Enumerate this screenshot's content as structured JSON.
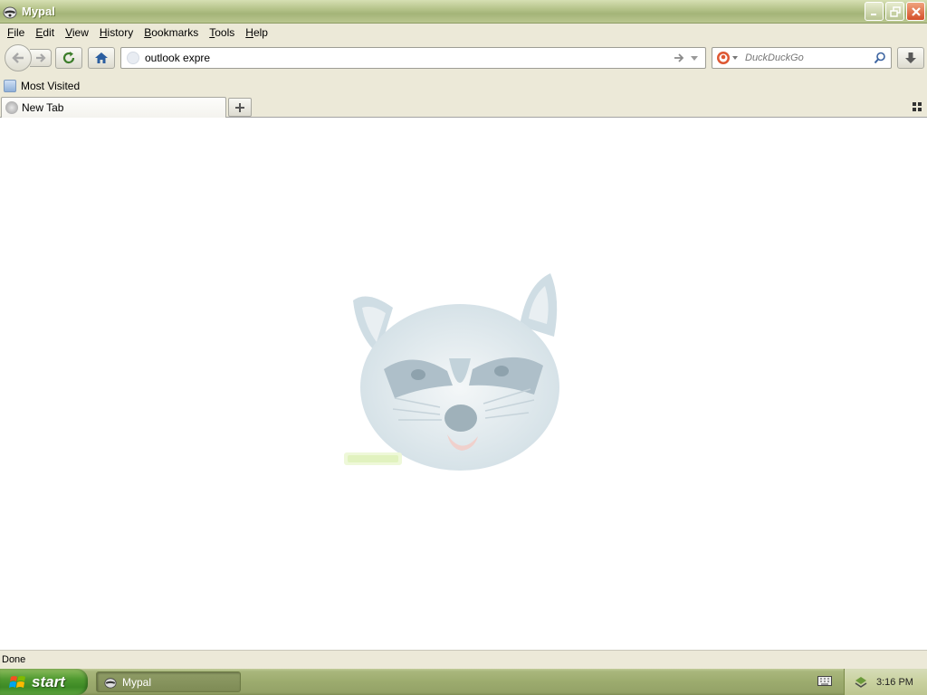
{
  "window": {
    "title": "Mypal"
  },
  "menu": {
    "items": [
      {
        "first": "F",
        "rest": "ile"
      },
      {
        "first": "E",
        "rest": "dit"
      },
      {
        "first": "V",
        "rest": "iew"
      },
      {
        "first": "H",
        "rest": "istory"
      },
      {
        "first": "B",
        "rest": "ookmarks"
      },
      {
        "first": "T",
        "rest": "ools"
      },
      {
        "first": "H",
        "rest": "elp"
      }
    ]
  },
  "toolbar": {
    "url_value": "outlook expre",
    "search_placeholder": "DuckDuckGo"
  },
  "bookmarks": {
    "most_visited": "Most Visited"
  },
  "tabs": [
    {
      "label": "New Tab"
    }
  ],
  "status": {
    "text": "Done"
  },
  "taskbar": {
    "start_label": "start",
    "task_label": "Mypal",
    "clock": "3:16 PM"
  },
  "icons": {
    "back": "back-arrow-icon",
    "forward": "forward-arrow-icon",
    "reload": "reload-icon",
    "home": "home-icon",
    "download": "download-icon"
  },
  "colors": {
    "titlebar": "#b5c38a",
    "taskbar": "#9cab6e",
    "start": "#4f9930"
  }
}
